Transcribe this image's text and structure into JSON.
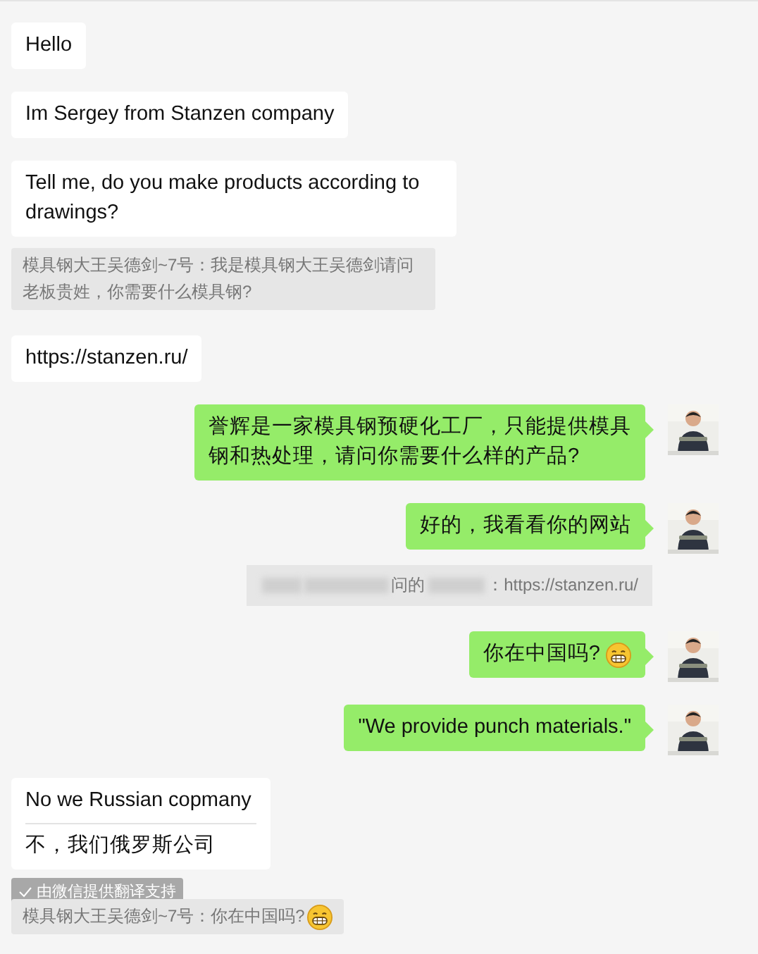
{
  "messages": [
    {
      "kind": "incoming",
      "text": "Hello"
    },
    {
      "kind": "incoming",
      "text": "Im Sergey from Stanzen company"
    },
    {
      "kind": "incoming",
      "text": "Tell me, do you make products according to drawings?"
    },
    {
      "kind": "quote",
      "text": "模具钢大王吴德剑~7号：我是模具钢大王吴德剑请问老板贵姓，你需要什么模具钢?"
    },
    {
      "kind": "incoming",
      "text": "https://stanzen.ru/"
    },
    {
      "kind": "outgoing",
      "text": "誉辉是一家模具钢预硬化工厂，只能提供模具钢和热处理，请问你需要什么样的产品?"
    },
    {
      "kind": "outgoing",
      "text": "好的，我看看你的网站"
    },
    {
      "kind": "blurred_quote",
      "parts": [
        "问的",
        "：https://stanzen.ru/"
      ]
    },
    {
      "kind": "outgoing",
      "text": "你在中国吗?",
      "emoji": true
    },
    {
      "kind": "outgoing",
      "text": "\"We provide punch materials.\""
    },
    {
      "kind": "incoming",
      "text": "No we Russian copmany",
      "translation": "不，我们俄罗斯公司",
      "translation_note": "由微信提供翻译支持"
    },
    {
      "kind": "quote",
      "text": "模具钢大王吴德剑~7号：你在中国吗?",
      "emoji": true
    }
  ]
}
